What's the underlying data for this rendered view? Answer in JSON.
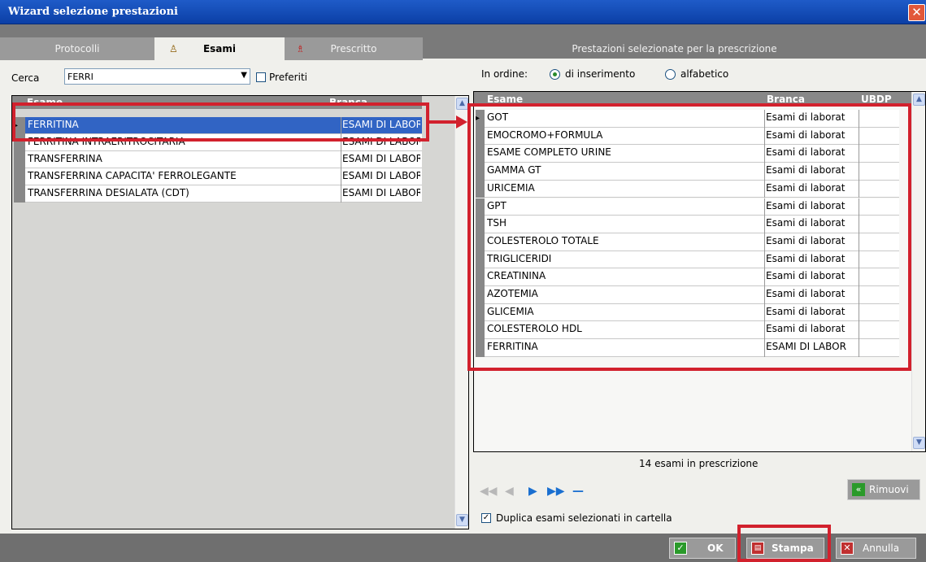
{
  "window": {
    "title": "Wizard selezione prestazioni",
    "close_glyph": "✕"
  },
  "tabs": [
    {
      "label": "Protocolli"
    },
    {
      "label": "Esami"
    },
    {
      "label": "Prescritto"
    }
  ],
  "right_panel_title": "Prestazioni selezionate per la prescrizione",
  "search": {
    "label": "Cerca",
    "value": "FERRI",
    "preferiti_label": "Preferiti"
  },
  "order": {
    "label": "In ordine:",
    "option1": "di inserimento",
    "option2": "alfabetico",
    "selected": "di inserimento"
  },
  "left_grid": {
    "headers": [
      "Esame",
      "Branca"
    ],
    "rows": [
      {
        "esame": "FERRITINA",
        "branca": "ESAMI DI LABOR"
      },
      {
        "esame": "FERRITINA INTRAERITROCITARIA",
        "branca": "ESAMI DI LABOR"
      },
      {
        "esame": "TRANSFERRINA",
        "branca": "ESAMI DI LABOR"
      },
      {
        "esame": "TRANSFERRINA CAPACITA' FERROLEGANTE",
        "branca": "ESAMI DI LABOR"
      },
      {
        "esame": "TRANSFERRINA DESIALATA (CDT)",
        "branca": "ESAMI DI LABOR"
      }
    ]
  },
  "right_grid": {
    "headers": [
      "Esame",
      "Branca",
      "UBDP"
    ],
    "rows": [
      {
        "esame": "GOT",
        "branca": "Esami di laborat"
      },
      {
        "esame": "EMOCROMO+FORMULA",
        "branca": "Esami di laborat"
      },
      {
        "esame": "ESAME COMPLETO URINE",
        "branca": "Esami di laborat"
      },
      {
        "esame": "GAMMA GT",
        "branca": "Esami di laborat"
      },
      {
        "esame": "URICEMIA",
        "branca": "Esami di laborat"
      },
      {
        "esame": "GPT",
        "branca": "Esami di laborat"
      },
      {
        "esame": "TSH",
        "branca": "Esami di laborat"
      },
      {
        "esame": "COLESTEROLO TOTALE",
        "branca": "Esami di laborat"
      },
      {
        "esame": "TRIGLICERIDI",
        "branca": "Esami di laborat"
      },
      {
        "esame": "CREATININA",
        "branca": "Esami di laborat"
      },
      {
        "esame": "AZOTEMIA",
        "branca": "Esami di laborat"
      },
      {
        "esame": "GLICEMIA",
        "branca": "Esami di laborat"
      },
      {
        "esame": "COLESTEROLO HDL",
        "branca": "Esami di laborat"
      },
      {
        "esame": "FERRITINA",
        "branca": "ESAMI DI LABOR"
      }
    ]
  },
  "count_text": "14 esami in prescrizione",
  "rimuovi_label": "Rimuovi",
  "duplica_label": "Duplica esami selezionati in cartella",
  "buttons": {
    "ok": "OK",
    "stampa": "Stampa",
    "annulla": "Annulla"
  },
  "colors": {
    "accent": "#3164c4",
    "highlight": "#d2212d"
  }
}
